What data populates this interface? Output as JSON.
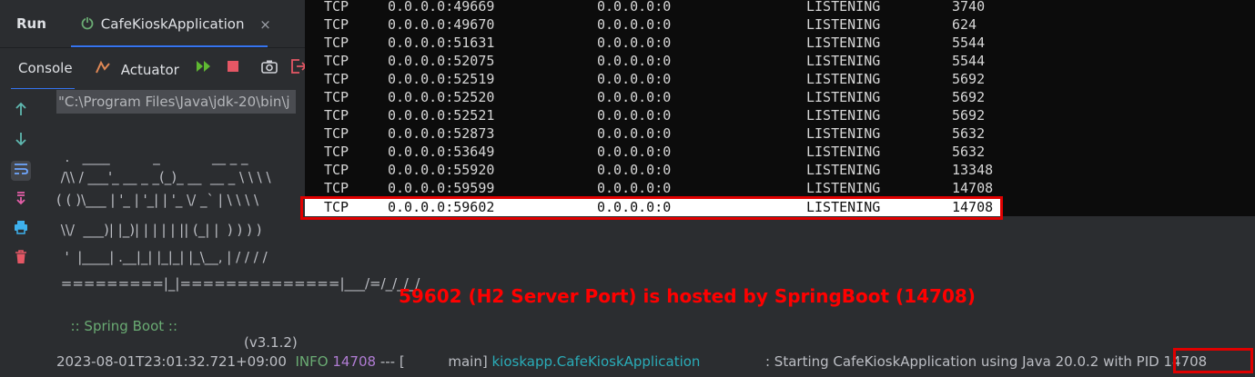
{
  "run_panel": {
    "title": "Run",
    "tab_label": "CafeKioskApplication",
    "tab_close": "×"
  },
  "toolbar": {
    "console_label": "Console",
    "actuator_label": "Actuator",
    "icons": [
      "rerun-icon",
      "stop-icon",
      "camera-icon",
      "exit-icon"
    ]
  },
  "sidebar": {
    "icons": [
      "up-arrow-icon",
      "down-arrow-icon",
      "soft-wrap-icon",
      "scroll-to-end-icon",
      "print-icon",
      "trash-icon"
    ]
  },
  "console": {
    "command_line": "\"C:\\Program Files\\Java\\jdk-20\\bin\\j",
    "banner": [
      "  .   ____          _            __ _ _",
      " /\\\\ / ___'_ __ _ _(_)_ __  __ _ \\ \\ \\ \\",
      "( ( )\\___ | '_ | '_| | '_ \\/ _` | \\ \\ \\ \\",
      " \\\\/  ___)| |_)| | | | | || (_| |  ) ) ) )",
      "  '  |____| .__|_| |_|_| |_\\__, | / / / /",
      " =========|_|==============|___/=/_/_/_/"
    ],
    "spring_label": ":: Spring Boot ::",
    "spring_version": "(v3.1.2)",
    "log": {
      "timestamp": "2023-08-01T23:01:32.721+09:00",
      "level": "INFO",
      "pid": "14708",
      "sep": "--- [",
      "thread": "main]",
      "logger": "kioskapp.CafeKioskApplication",
      "message": ": Starting CafeKioskApplication using Java 20.0.2 with",
      "pid_text": "PID 14708"
    }
  },
  "annotation": {
    "note": "59602 (H2 Server Port) is hosted by SpringBoot (14708)",
    "color": "#ff0000"
  },
  "netstat": {
    "rows": [
      {
        "proto": "TCP",
        "local": "0.0.0.0:49669",
        "foreign": "0.0.0.0:0",
        "state": "LISTENING",
        "pid": "3740"
      },
      {
        "proto": "TCP",
        "local": "0.0.0.0:49670",
        "foreign": "0.0.0.0:0",
        "state": "LISTENING",
        "pid": "624"
      },
      {
        "proto": "TCP",
        "local": "0.0.0.0:51631",
        "foreign": "0.0.0.0:0",
        "state": "LISTENING",
        "pid": "5544"
      },
      {
        "proto": "TCP",
        "local": "0.0.0.0:52075",
        "foreign": "0.0.0.0:0",
        "state": "LISTENING",
        "pid": "5544"
      },
      {
        "proto": "TCP",
        "local": "0.0.0.0:52519",
        "foreign": "0.0.0.0:0",
        "state": "LISTENING",
        "pid": "5692"
      },
      {
        "proto": "TCP",
        "local": "0.0.0.0:52520",
        "foreign": "0.0.0.0:0",
        "state": "LISTENING",
        "pid": "5692"
      },
      {
        "proto": "TCP",
        "local": "0.0.0.0:52521",
        "foreign": "0.0.0.0:0",
        "state": "LISTENING",
        "pid": "5692"
      },
      {
        "proto": "TCP",
        "local": "0.0.0.0:52873",
        "foreign": "0.0.0.0:0",
        "state": "LISTENING",
        "pid": "5632"
      },
      {
        "proto": "TCP",
        "local": "0.0.0.0:53649",
        "foreign": "0.0.0.0:0",
        "state": "LISTENING",
        "pid": "5632"
      },
      {
        "proto": "TCP",
        "local": "0.0.0.0:55920",
        "foreign": "0.0.0.0:0",
        "state": "LISTENING",
        "pid": "13348"
      },
      {
        "proto": "TCP",
        "local": "0.0.0.0:59599",
        "foreign": "0.0.0.0:0",
        "state": "LISTENING",
        "pid": "14708"
      },
      {
        "proto": "TCP",
        "local": "0.0.0.0:59602",
        "foreign": "0.0.0.0:0",
        "state": "LISTENING",
        "pid": "14708",
        "highlighted": true
      }
    ]
  }
}
